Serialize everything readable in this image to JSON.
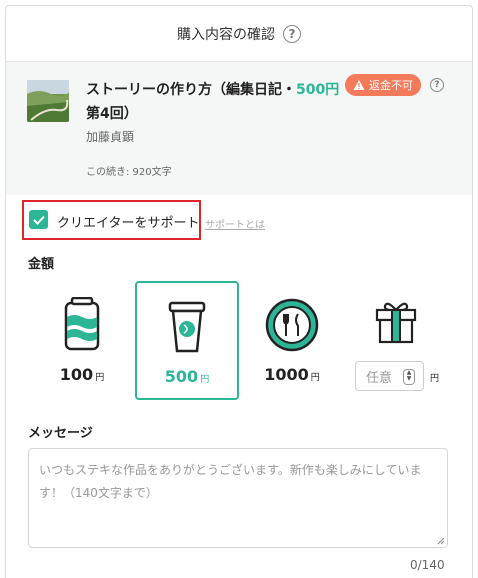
{
  "header": {
    "title": "購入内容の確認",
    "help_glyph": "?"
  },
  "article": {
    "title_main": "ストーリーの作り方（編集日記・",
    "price": "500円",
    "title_tail": "第4回）",
    "badge": "返金不可",
    "author": "加藤貞顕",
    "continuation": "この続き: 920文字"
  },
  "support": {
    "checked": true,
    "label": "クリエイターをサポート",
    "link": "サポートとは"
  },
  "amount": {
    "label": "金額",
    "options": [
      {
        "value": "100",
        "unit": "円",
        "icon": "can-icon",
        "selected": false
      },
      {
        "value": "500",
        "unit": "円",
        "icon": "coffee-cup-icon",
        "selected": true
      },
      {
        "value": "1000",
        "unit": "円",
        "icon": "plate-icon",
        "selected": false
      }
    ],
    "free_input_placeholder": "任意",
    "free_unit": "円",
    "free_icon": "gift-icon"
  },
  "message": {
    "label": "メッセージ",
    "placeholder": "いつもステキな作品をありがとうございます。新作も楽しみにしています！（140文字まで）",
    "counter": "0/140"
  },
  "colors": {
    "accent": "#2cb696",
    "badge": "#f37a5b",
    "highlight": "#e0242b"
  }
}
